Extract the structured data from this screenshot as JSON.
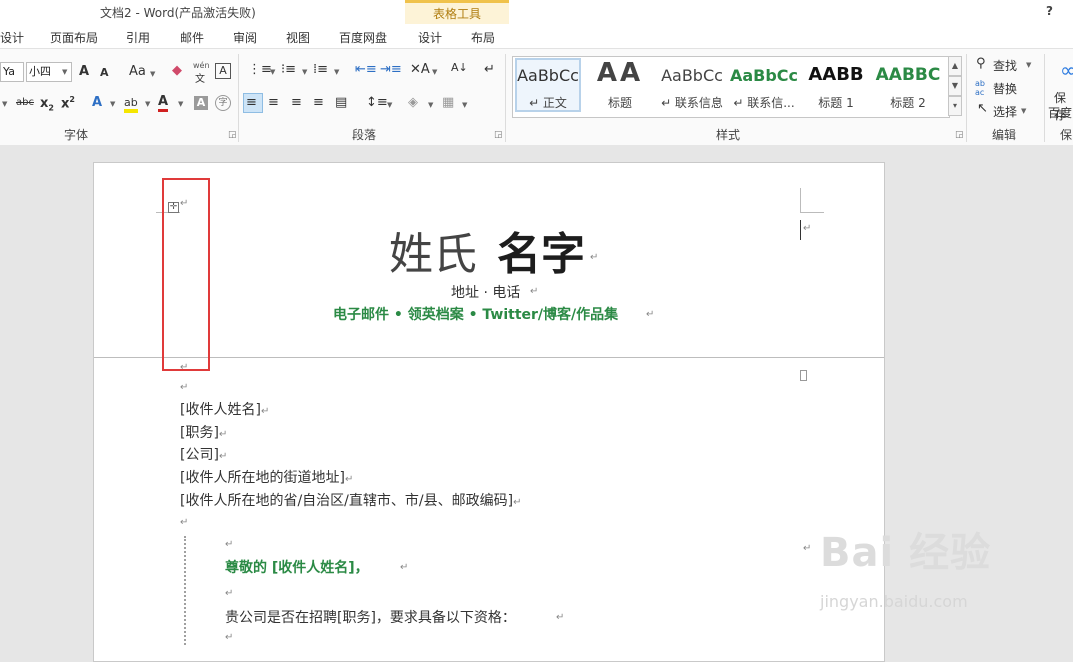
{
  "window": {
    "title": "文档2 - Word(产品激活失败)",
    "help": "?",
    "close": "×"
  },
  "context_tab_group": {
    "label": "表格工具"
  },
  "tabs": [
    "设计",
    "页面布局",
    "引用",
    "邮件",
    "审阅",
    "视图",
    "百度网盘",
    "设计",
    "布局"
  ],
  "ribbon": {
    "font": {
      "name_value": "Ya",
      "size_value": "小四",
      "group_label": "字体"
    },
    "paragraph": {
      "group_label": "段落"
    },
    "styles": {
      "group_label": "样式",
      "items": [
        {
          "preview": "AaBbCc",
          "label": "↵ 正文"
        },
        {
          "preview": "AA",
          "label": "标题"
        },
        {
          "preview": "AaBbCc",
          "label": "↵ 联系信息"
        },
        {
          "preview": "AaBbCc",
          "label": "↵ 联系信..."
        },
        {
          "preview": "AABB",
          "label": "标题 1"
        },
        {
          "preview": "AABBC",
          "label": "标题 2"
        }
      ]
    },
    "editing": {
      "group_label": "编辑",
      "find": "查找",
      "replace": "替换",
      "select": "选择"
    },
    "save": {
      "line1": "保存",
      "line2": "百度",
      "group_label": "保"
    },
    "glyphs": {
      "a_up": "A",
      "a_down": "A",
      "aa": "Aa",
      "wen": "wén",
      "wen2": "文",
      "boxA": "A",
      "abc": "abc",
      "x2a": "x",
      "x2b": "x",
      "fontA": "A",
      "aby": "ab",
      "colA": "A",
      "grayA": "A",
      "zi": "字",
      "sort": "A↓",
      "para": "¶"
    }
  },
  "document": {
    "header": {
      "name_light": "姓氏",
      "name_bold": "名字",
      "address": "地址 · 电话",
      "contact": "电子邮件 • 领英档案 • Twitter/博客/作品集"
    },
    "recipient_lines": [
      "[收件人姓名]",
      "[职务]",
      "[公司]",
      "[收件人所在地的街道地址]",
      "[收件人所在地的省/自治区/直辖市、市/县、邮政编码]"
    ],
    "greeting": "尊敬的 [收件人姓名]，",
    "body": "贵公司是否在招聘[职务]，要求具备以下资格：",
    "para_mark": "↵"
  },
  "watermark": {
    "main": "Bai 经验",
    "sub": "jingyan.baidu.com"
  },
  "colors": {
    "accent_green": "#2b8a45",
    "highlight_red": "#e03a3a",
    "context_tab": "#f0c24b"
  }
}
